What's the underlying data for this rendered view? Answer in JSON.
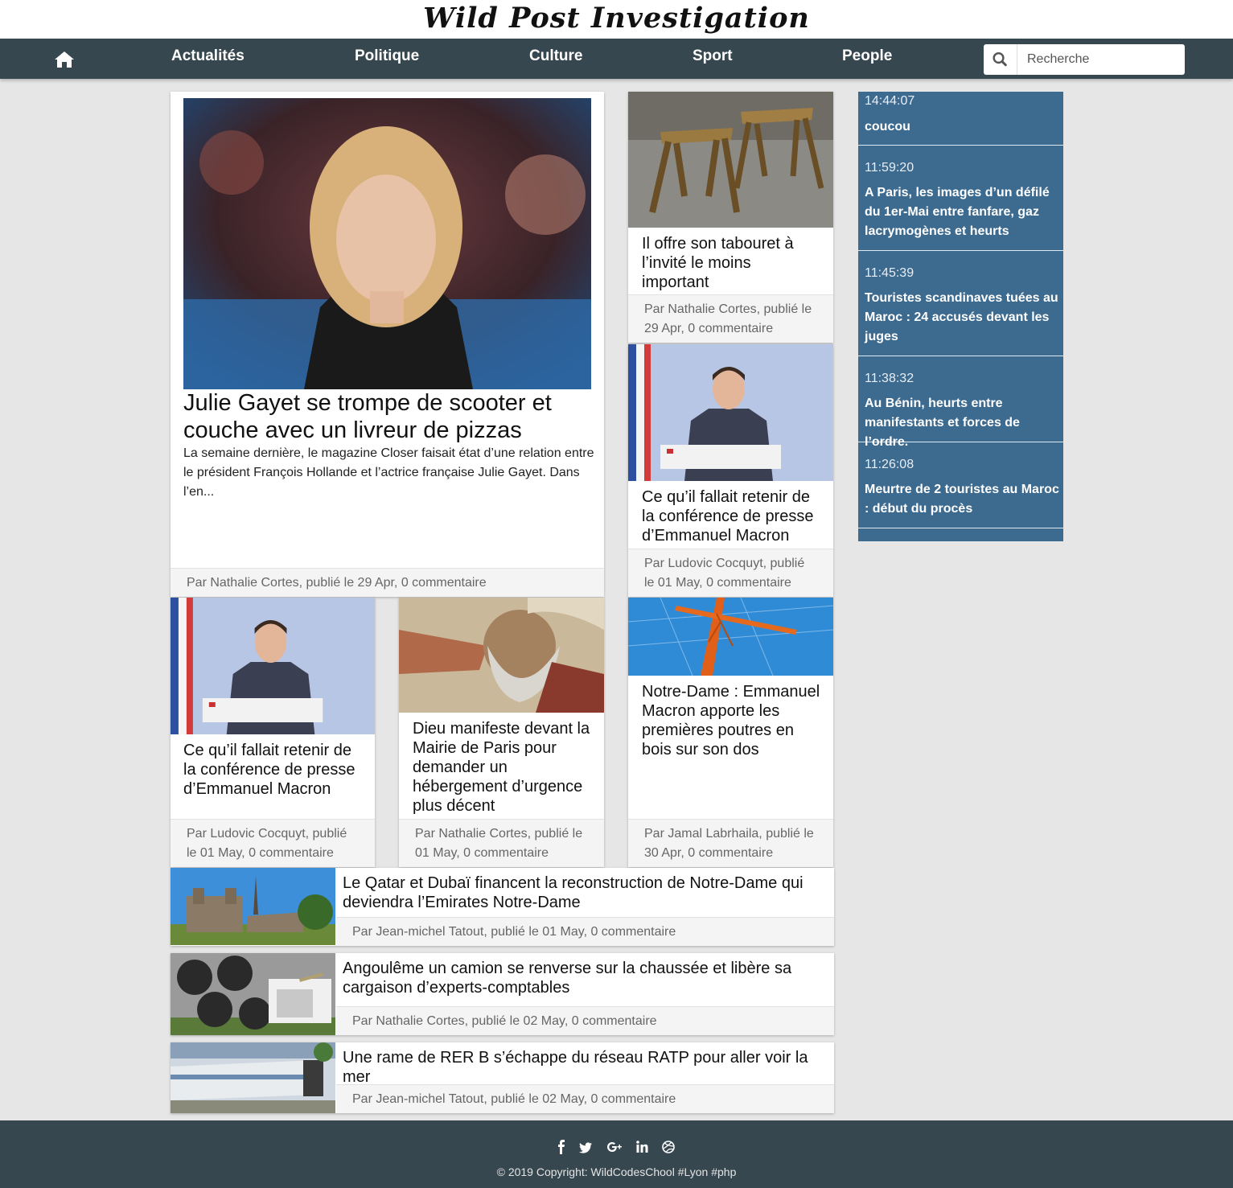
{
  "site": {
    "title": "Wild Post Investigation"
  },
  "nav": {
    "items": [
      "Actualités",
      "Politique",
      "Culture",
      "Sport",
      "People"
    ],
    "search_placeholder": "Recherche"
  },
  "hero": {
    "title": "Julie Gayet se trompe de scooter et couche avec un livreur de pizzas",
    "excerpt": "La semaine dernière, le magazine Closer faisait état d’une relation entre le président François Hollande et l’actrice française Julie Gayet. Dans l’en...",
    "meta": "Par Nathalie Cortes, publié le 29 Apr, 0 commentaire"
  },
  "cards": [
    {
      "title": "Il offre son tabouret à l’invité le moins important",
      "meta": "Par Nathalie Cortes, publié le 29 Apr, 0 commentaire"
    },
    {
      "title": "Ce qu’il fallait retenir de la conférence de presse d’Emmanuel Macron",
      "meta": "Par Ludovic Cocquyt, publié le 01 May, 0 commentaire"
    },
    {
      "title": "Ce qu’il fallait retenir de la conférence de presse d’Emmanuel Macron",
      "meta": "Par Ludovic Cocquyt, publié le 01 May, 0 commentaire"
    },
    {
      "title": "Dieu manifeste devant la Mairie de Paris pour demander un hébergement d’urgence plus décent",
      "meta": "Par Nathalie Cortes, publié le 01 May, 0 commentaire"
    },
    {
      "title": "Notre-Dame : Emmanuel Macron apporte les premières poutres en bois sur son dos",
      "meta": "Par Jamal Labrhaila, publié le 30 Apr, 0 commentaire"
    }
  ],
  "list": [
    {
      "title": "Le Qatar et Dubaï financent la reconstruction de Notre-Dame qui deviendra l’Emirates Notre-Dame",
      "meta": "Par Jean-michel Tatout, publié le 01 May, 0 commentaire"
    },
    {
      "title": "Angoulême un camion se renverse sur la chaussée et libère sa cargaison d’experts-comptables",
      "meta": "Par Nathalie Cortes, publié le 02 May, 0 commentaire"
    },
    {
      "title": "Une rame de RER B s’échappe du réseau RATP pour aller voir la mer",
      "meta": "Par Jean-michel Tatout, publié le 02 May, 0 commentaire"
    }
  ],
  "feed": [
    {
      "time": "14:44:07",
      "text": "coucou"
    },
    {
      "time": "11:59:20",
      "text": "A Paris, les images d’un défilé du 1er-Mai entre fanfare, gaz lacrymogènes et heurts"
    },
    {
      "time": "11:45:39",
      "text": "Touristes scandinaves tuées au Maroc : 24 accusés devant les juges"
    },
    {
      "time": "11:38:32",
      "text": "Au Bénin, heurts entre manifestants et forces de l’ordre."
    },
    {
      "time": "11:26:08",
      "text": "Meurtre de 2 touristes au Maroc : début du procès"
    }
  ],
  "footer": {
    "social": [
      "facebook-icon",
      "twitter-icon",
      "google-plus-icon",
      "linkedin-icon",
      "dribbble-icon"
    ],
    "copyright": "© 2019 Copyright: WildCodesChool #Lyon #php"
  }
}
